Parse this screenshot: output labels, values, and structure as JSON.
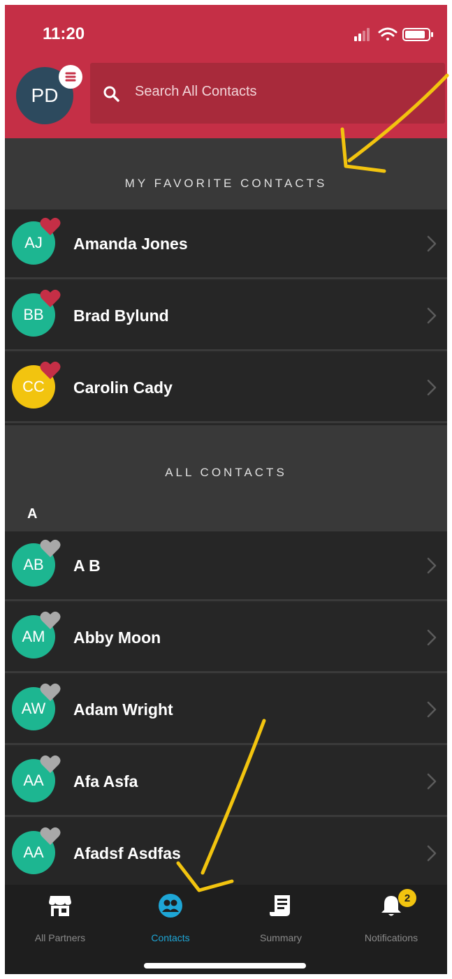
{
  "status_bar": {
    "time": "11:20"
  },
  "header": {
    "avatar_initials": "PD",
    "search_placeholder": "Search All Contacts"
  },
  "favorites": {
    "title": "MY FAVORITE CONTACTS",
    "contacts": [
      {
        "initials": "AJ",
        "name": "Amanda Jones",
        "avatar_color": "#1db691"
      },
      {
        "initials": "BB",
        "name": "Brad Bylund",
        "avatar_color": "#1db691"
      },
      {
        "initials": "CC",
        "name": "Carolin Cady",
        "avatar_color": "#f2c40f"
      }
    ],
    "heart_color": "#c52f46"
  },
  "all_contacts": {
    "title": "ALL CONTACTS",
    "letter": "A",
    "contacts": [
      {
        "initials": "AB",
        "name": "A B",
        "avatar_color": "#1db691"
      },
      {
        "initials": "AM",
        "name": "Abby Moon",
        "avatar_color": "#1db691"
      },
      {
        "initials": "AW",
        "name": "Adam Wright",
        "avatar_color": "#1db691"
      },
      {
        "initials": "AA",
        "name": "Afa Asfa",
        "avatar_color": "#1db691"
      },
      {
        "initials": "AA",
        "name": "Afadsf Asdfas",
        "avatar_color": "#1db691"
      }
    ],
    "heart_color": "#a9a9a9"
  },
  "tabbar": {
    "tabs": [
      {
        "label": "All Partners",
        "icon": "store-icon"
      },
      {
        "label": "Contacts",
        "icon": "contacts-icon",
        "active": true
      },
      {
        "label": "Summary",
        "icon": "summary-icon"
      },
      {
        "label": "Notifications",
        "icon": "bell-icon",
        "badge": "2"
      }
    ]
  },
  "colors": {
    "brand_red": "#c52f46",
    "accent_blue": "#1ea6d6",
    "annotation_yellow": "#f2c40f"
  }
}
